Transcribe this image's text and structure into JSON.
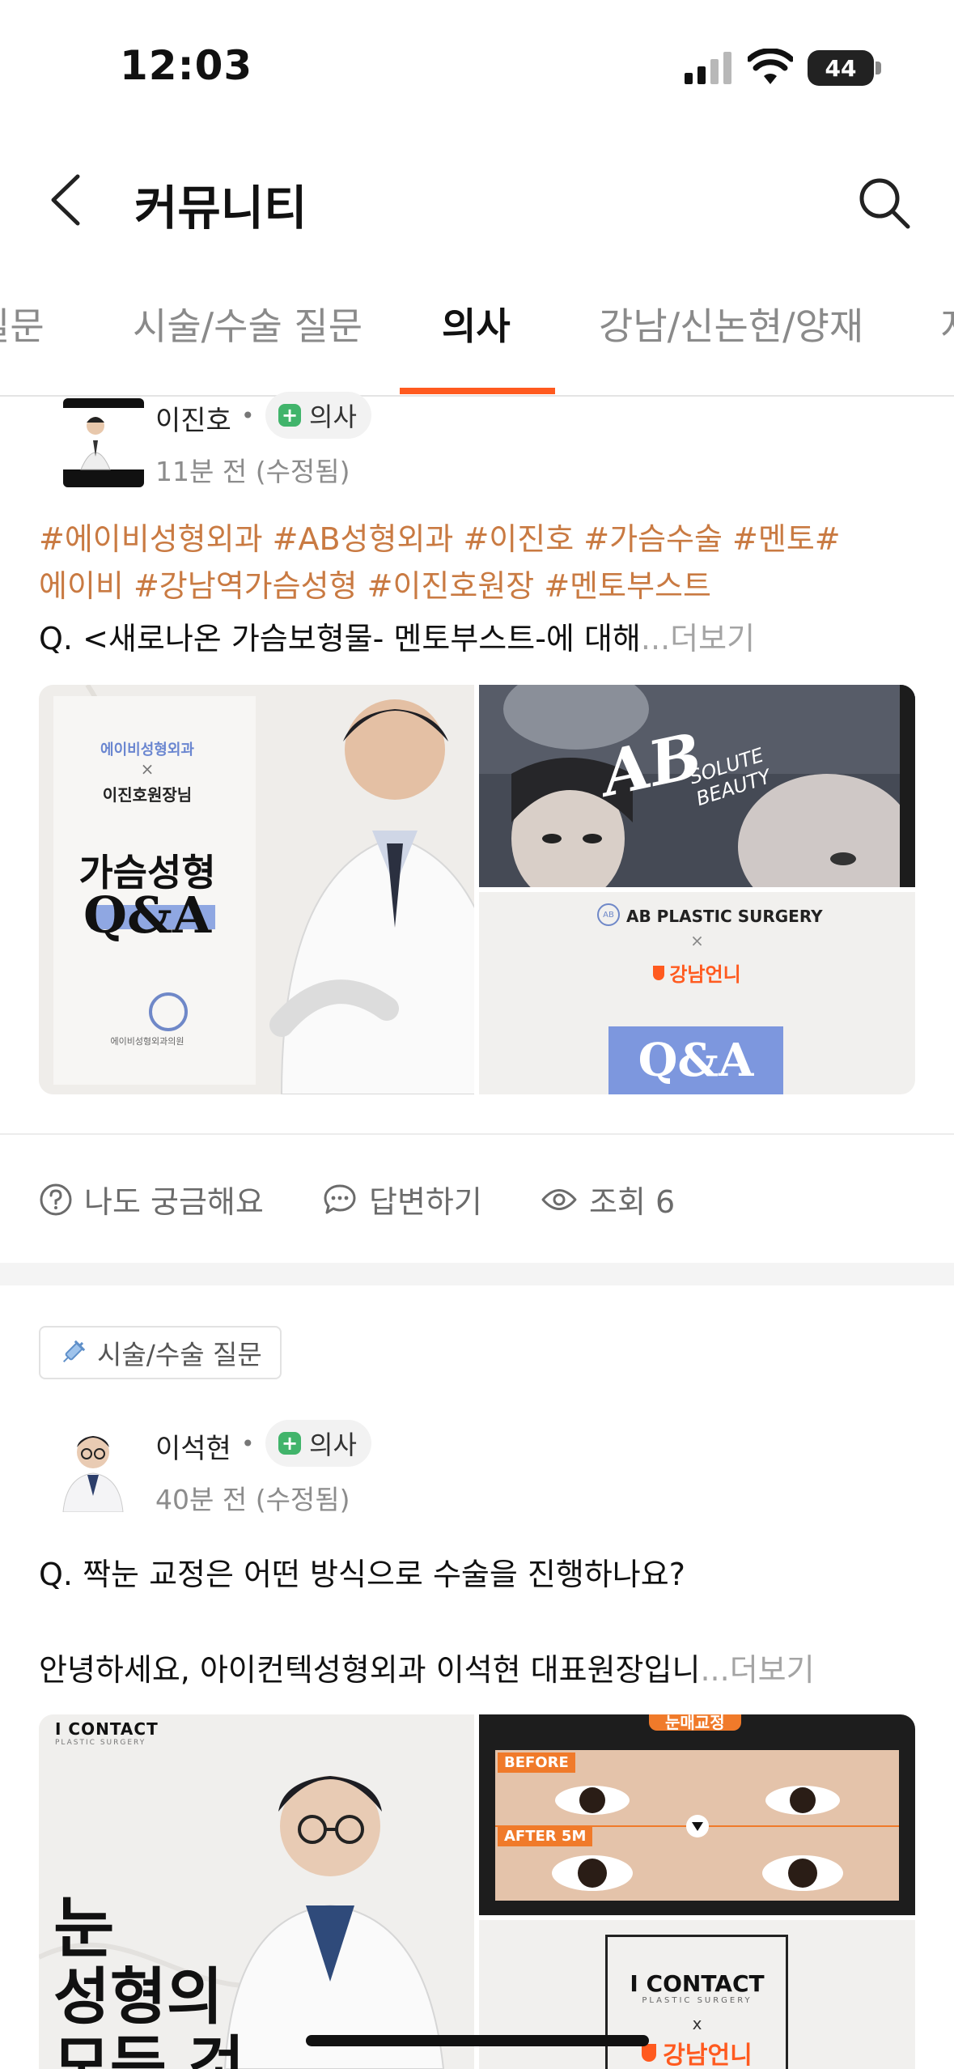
{
  "status_bar": {
    "time": "12:03",
    "battery": "44"
  },
  "header": {
    "title": "커뮤니티"
  },
  "tabs": [
    {
      "label": "질문",
      "active": false
    },
    {
      "label": "시술/수술 질문",
      "active": false
    },
    {
      "label": "의사",
      "active": true
    },
    {
      "label": "강남/신논현/양재",
      "active": false
    },
    {
      "label": "지",
      "active": false
    }
  ],
  "colors": {
    "accent": "#ff5a1f",
    "hashtag": "#c97a42",
    "doctor_badge": "#41b46b"
  },
  "posts": [
    {
      "author": "이진호",
      "role_badge": "의사",
      "time": "11분 전 (수정됨)",
      "hashtags_line1": "#에이비성형외과 #AB성형외과 #이진호 #가슴수술 #멘토#",
      "hashtags_line2": "에이비 #강남역가슴성형 #이진호원장 #멘토부스트",
      "question": "Q.  <새로나온 가슴보형물- 멘토부스트-에 대해",
      "more_ellipsis": "...",
      "more_label": "더보기",
      "image_left": {
        "clinic": "에이비성형외과",
        "cross": "×",
        "doctor": "이진호원장님",
        "title_line1": "가슴성형",
        "title_line2": "Q&A",
        "logo_caption": "에이비성형외과의원"
      },
      "image_top_right": {
        "brand_big": "AB",
        "brand_script": "SOLUTE BEAUTY"
      },
      "image_bottom_right": {
        "brand": "AB PLASTIC SURGERY",
        "cross": "×",
        "partner": "강남언니",
        "title": "Q&A"
      },
      "actions": {
        "curious": "나도 궁금해요",
        "answer": "답변하기",
        "views": "조회 6"
      }
    },
    {
      "category": "시술/수술 질문",
      "author": "이석현",
      "role_badge": "의사",
      "time": "40분 전 (수정됨)",
      "question": "Q. 짝눈 교정은 어떤 방식으로 수술을 진행하나요?",
      "body": "안녕하세요, 아이컨텍성형외과 이석현 대표원장입니",
      "more_ellipsis": "...",
      "more_label": "더보기",
      "image_left": {
        "brand": "I CONTACT",
        "brand_sub": "PLASTIC SURGERY",
        "title_line1": "눈",
        "title_line2": "성형의",
        "title_line3": "모든 것"
      },
      "image_top_right": {
        "banner": "눈매교정",
        "before": "BEFORE",
        "after": "AFTER 5M"
      },
      "image_bottom_right": {
        "brand": "I CONTACT",
        "brand_sub": "PLASTIC SURGERY",
        "cross": "x",
        "partner": "강남언니"
      }
    }
  ]
}
